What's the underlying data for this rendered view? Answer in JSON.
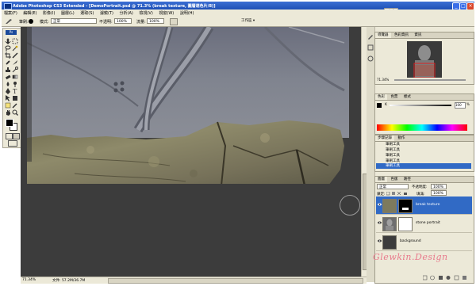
{
  "window": {
    "title": "Adobe Photoshop CS3 Extended - [DemoPortrait.psd @ 71.3% (break texture, 圖層遮色片/8)]",
    "minimize_label": "_",
    "maximize_label": "□",
    "close_label": "×",
    "badge_label": "完成"
  },
  "menu": {
    "items": [
      "檔案(F)",
      "編輯(E)",
      "影像(I)",
      "圖層(L)",
      "選取(S)",
      "濾鏡(T)",
      "分析(A)",
      "檢視(V)",
      "視窗(W)",
      "說明(H)"
    ]
  },
  "options": {
    "mode_label": "模式:",
    "mode_value": "正常",
    "opacity_label": "不透明:",
    "opacity_value": "100%",
    "flow_label": "流量:",
    "flow_value": "100%",
    "workspace_label": "工作區 ▾",
    "brush_label": "筆刷:"
  },
  "navigator": {
    "tabs": [
      "導覽器",
      "色彩資訊",
      "資訊"
    ],
    "zoom": "71.34%"
  },
  "color": {
    "tabs": [
      "色彩",
      "色票",
      "樣式"
    ],
    "channel_label": "K",
    "channel_value": "100",
    "percent": "%"
  },
  "history": {
    "tabs": [
      "步驟記錄",
      "動作"
    ],
    "items": [
      "筆刷工具",
      "筆刷工具",
      "筆刷工具",
      "筆刷工具",
      "筆刷工具"
    ],
    "active_index": 4
  },
  "layers": {
    "tabs": [
      "圖層",
      "色版",
      "路徑"
    ],
    "blend_mode": "正常",
    "opacity_label": "不透明度:",
    "opacity_value": "100%",
    "lock_label": "鎖定:",
    "fill_label": "填滿:",
    "fill_value": "100%",
    "items": [
      {
        "name": "break texture",
        "selected": true
      },
      {
        "name": "stone portrait",
        "selected": false
      },
      {
        "name": "background",
        "selected": false
      }
    ]
  },
  "status": {
    "zoom": "71.34%",
    "doc_info": "文件: 57.2M/36.7M"
  },
  "watermark": "Glewkin.Design",
  "colors": {
    "titlebar": "#1e4fb5",
    "chrome": "#ece9d8",
    "doc_bg": "#3c3c3c",
    "selected": "#316ac5",
    "watermark": "#e87a8c"
  }
}
